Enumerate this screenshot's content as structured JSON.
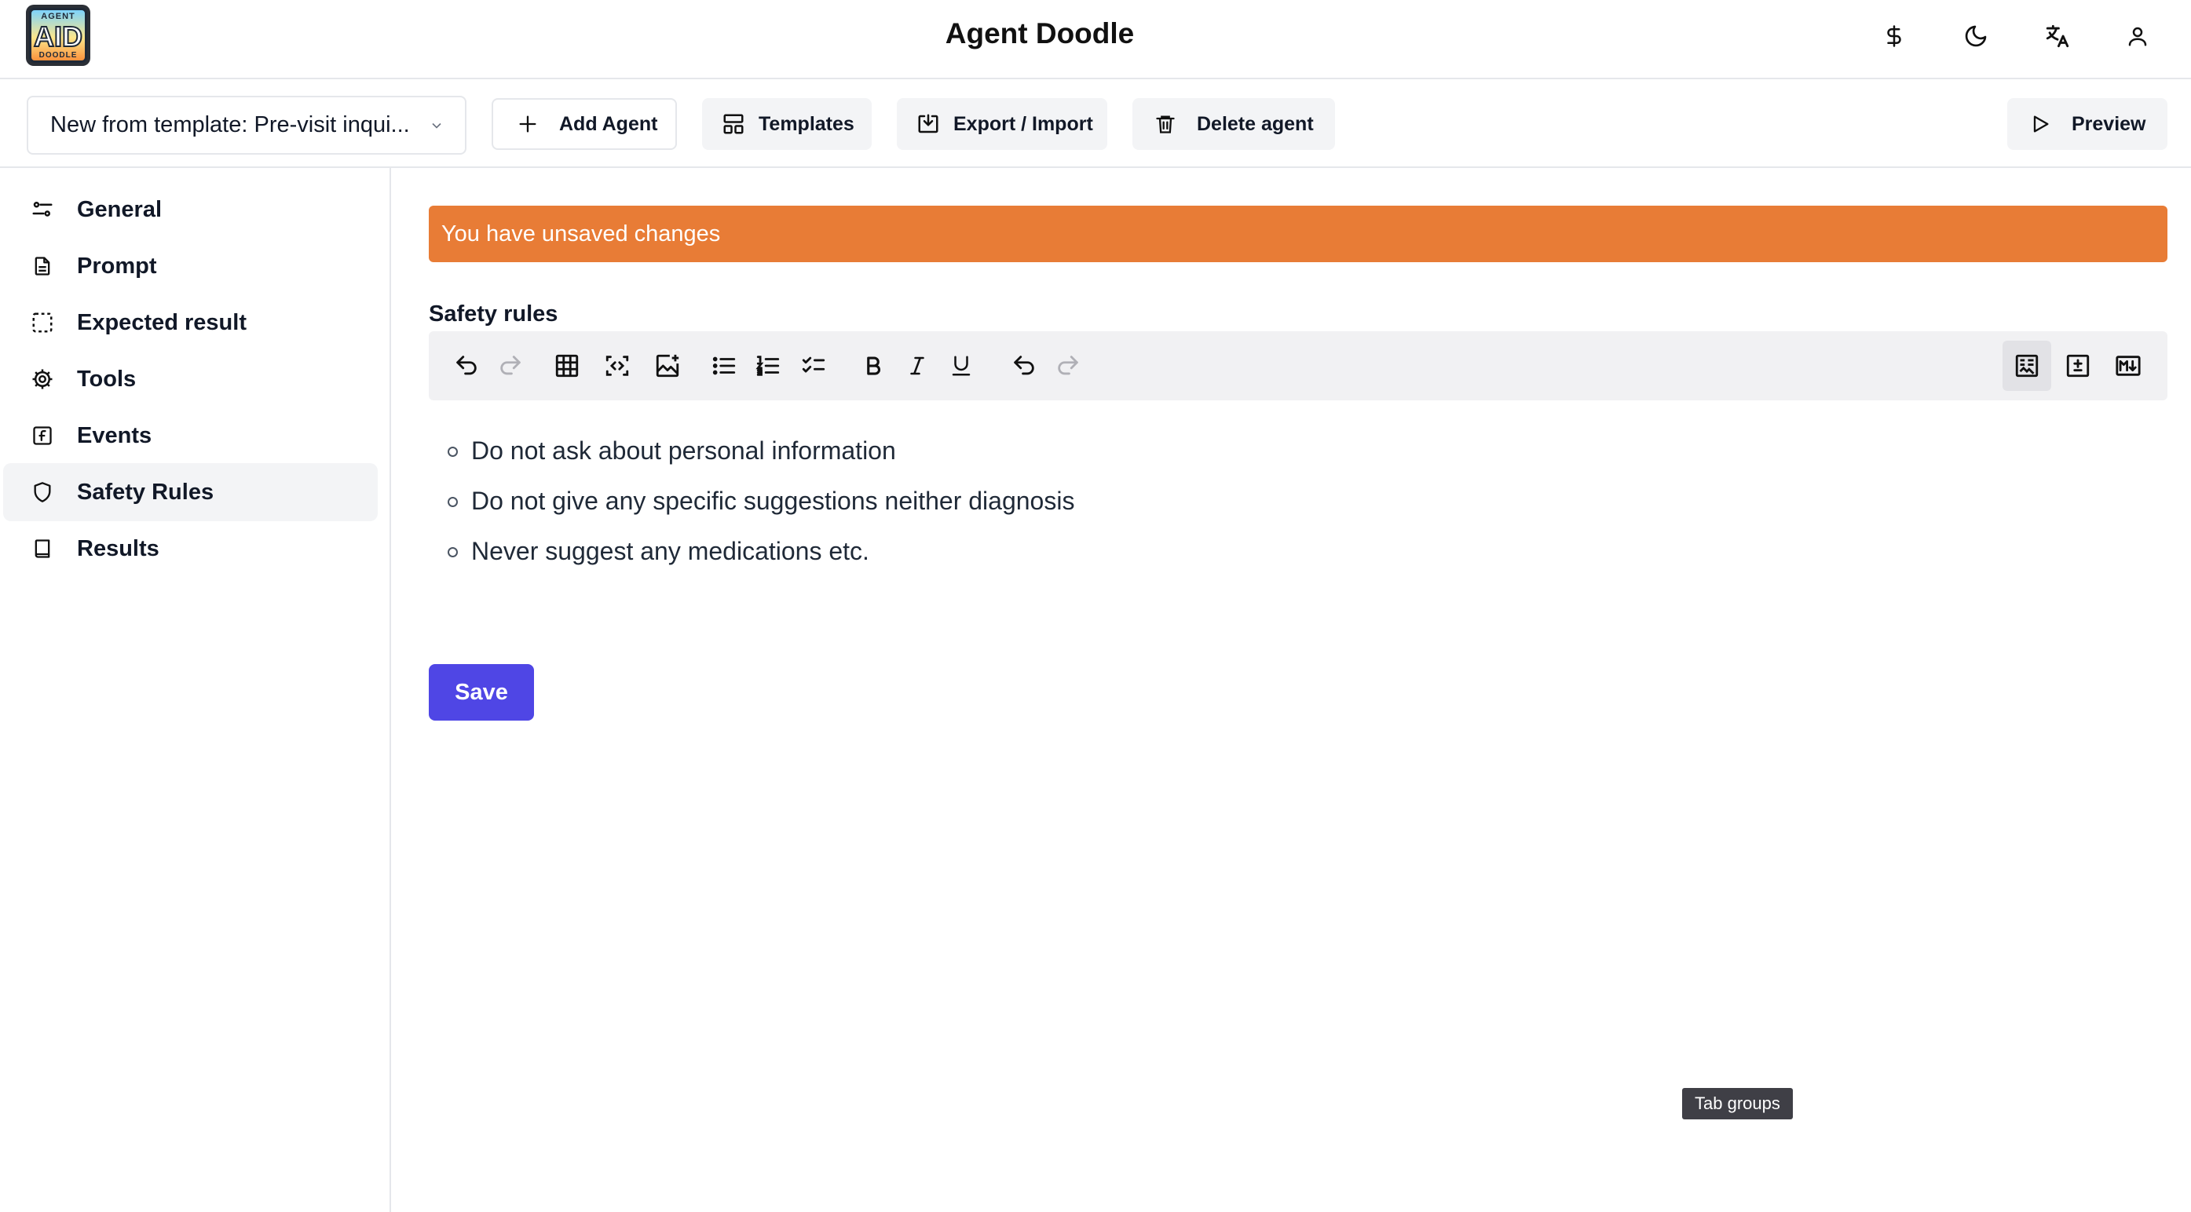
{
  "app": {
    "title": "Agent Doodle",
    "logo": {
      "top_text": "AGENT",
      "main_text": "AID",
      "bottom_text": "DOODLE"
    },
    "header_icons": [
      "dollar-icon",
      "moon-icon",
      "translate-icon",
      "user-icon"
    ]
  },
  "toolbar": {
    "agent_select_value": "New from template: Pre-visit inqui...",
    "add_agent_label": "Add Agent",
    "templates_label": "Templates",
    "export_import_label": "Export / Import",
    "delete_agent_label": "Delete agent",
    "preview_label": "Preview"
  },
  "sidebar": {
    "items": [
      {
        "label": "General",
        "icon": "sliders-icon",
        "active": false
      },
      {
        "label": "Prompt",
        "icon": "document-icon",
        "active": false
      },
      {
        "label": "Expected result",
        "icon": "dashed-square-icon",
        "active": false
      },
      {
        "label": "Tools",
        "icon": "gear-icon",
        "active": false
      },
      {
        "label": "Events",
        "icon": "function-icon",
        "active": false
      },
      {
        "label": "Safety Rules",
        "icon": "shield-icon",
        "active": true
      },
      {
        "label": "Results",
        "icon": "book-icon",
        "active": false
      }
    ]
  },
  "main": {
    "banner_text": "You have unsaved changes",
    "banner_color": "#e87c36",
    "section_label": "Safety rules",
    "rules": [
      "Do not ask about personal information",
      "Do not give any specific suggestions neither diagnosis",
      "Never suggest any medications etc."
    ],
    "save_label": "Save",
    "save_color": "#4f46e5",
    "tooltip_text": "Tab groups"
  }
}
